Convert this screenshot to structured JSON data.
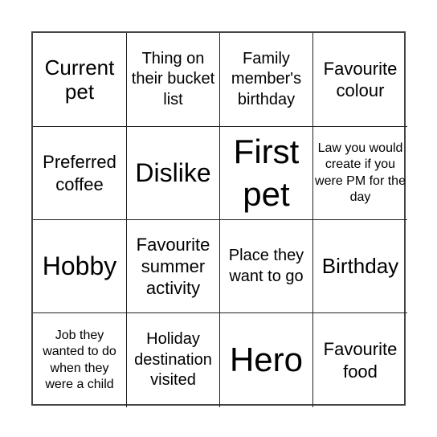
{
  "board": {
    "rows": [
      [
        {
          "text": "Current pet",
          "size": "s-lm"
        },
        {
          "text": "Thing on their bucket list",
          "size": "s-ms"
        },
        {
          "text": "Family member's birthday",
          "size": "s-ms"
        },
        {
          "text": "Favourite colour",
          "size": "s-m"
        }
      ],
      [
        {
          "text": "Preferred coffee",
          "size": "s-m"
        },
        {
          "text": "Dislike",
          "size": "s-l"
        },
        {
          "text": "First pet",
          "size": "s-xl"
        },
        {
          "text": "Law you would create if you were PM for the day",
          "size": "s-s"
        }
      ],
      [
        {
          "text": "Hobby",
          "size": "s-l"
        },
        {
          "text": "Favourite summer activity",
          "size": "s-m"
        },
        {
          "text": "Place they want to go",
          "size": "s-ms"
        },
        {
          "text": "Birthday",
          "size": "s-lm"
        }
      ],
      [
        {
          "text": "Job they wanted to do when they were a child",
          "size": "s-s"
        },
        {
          "text": "Holiday destination visited",
          "size": "s-ms"
        },
        {
          "text": "Hero",
          "size": "s-xl"
        },
        {
          "text": "Favourite food",
          "size": "s-m"
        }
      ]
    ]
  }
}
